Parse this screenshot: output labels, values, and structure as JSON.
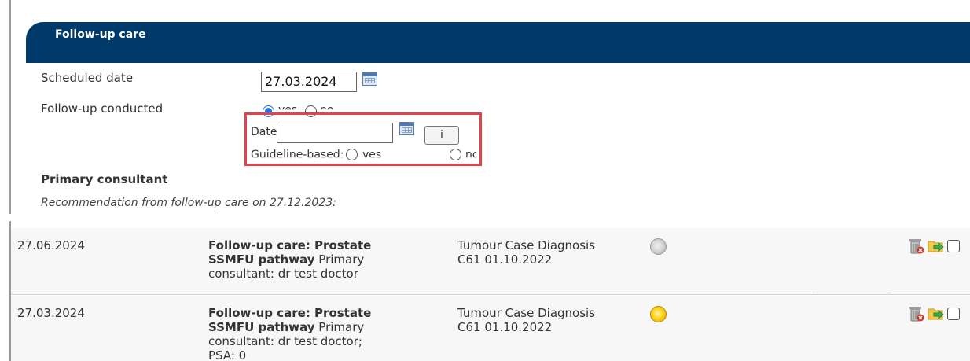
{
  "panel": {
    "title": "Follow-up care",
    "scheduled_date_label": "Scheduled date",
    "scheduled_date_value": "27.03.2024",
    "conducted_label": "Follow-up conducted",
    "conducted_yes": "yes",
    "conducted_no": "no",
    "conducted_selected": "yes",
    "date_label": "Date",
    "date_value": "",
    "info_button": "i",
    "guideline_label": "Guideline-based:",
    "guideline_yes": "yes",
    "guideline_no": "no",
    "primary_consultant_heading": "Primary consultant",
    "recommendation_prefix": "Recommendation from follow-up care on ",
    "recommendation_date": "27.12.2023",
    "recommendation_suffix": ":"
  },
  "highlight_color": "#e0454b",
  "header_color": "#003a6b",
  "rows": [
    {
      "date": "27.06.2024",
      "title_line1": "Follow-up care: Prostate",
      "title_line2_bold": "SSMFU pathway",
      "title_line2_rest": " Primary",
      "title_line3": "consultant: dr test doctor",
      "case_line1": "Tumour Case Diagnosis",
      "case_line2": "C61 01.10.2022",
      "status": "grey"
    },
    {
      "date": "27.03.2024",
      "title_line1": "Follow-up care: Prostate",
      "title_line2_bold": "SSMFU pathway",
      "title_line2_rest": " Primary",
      "title_line3": "consultant: dr test doctor;",
      "title_line4": "PSA: 0",
      "case_line1": "Tumour Case Diagnosis",
      "case_line2": "C61 01.10.2022",
      "status": "yellow"
    }
  ]
}
